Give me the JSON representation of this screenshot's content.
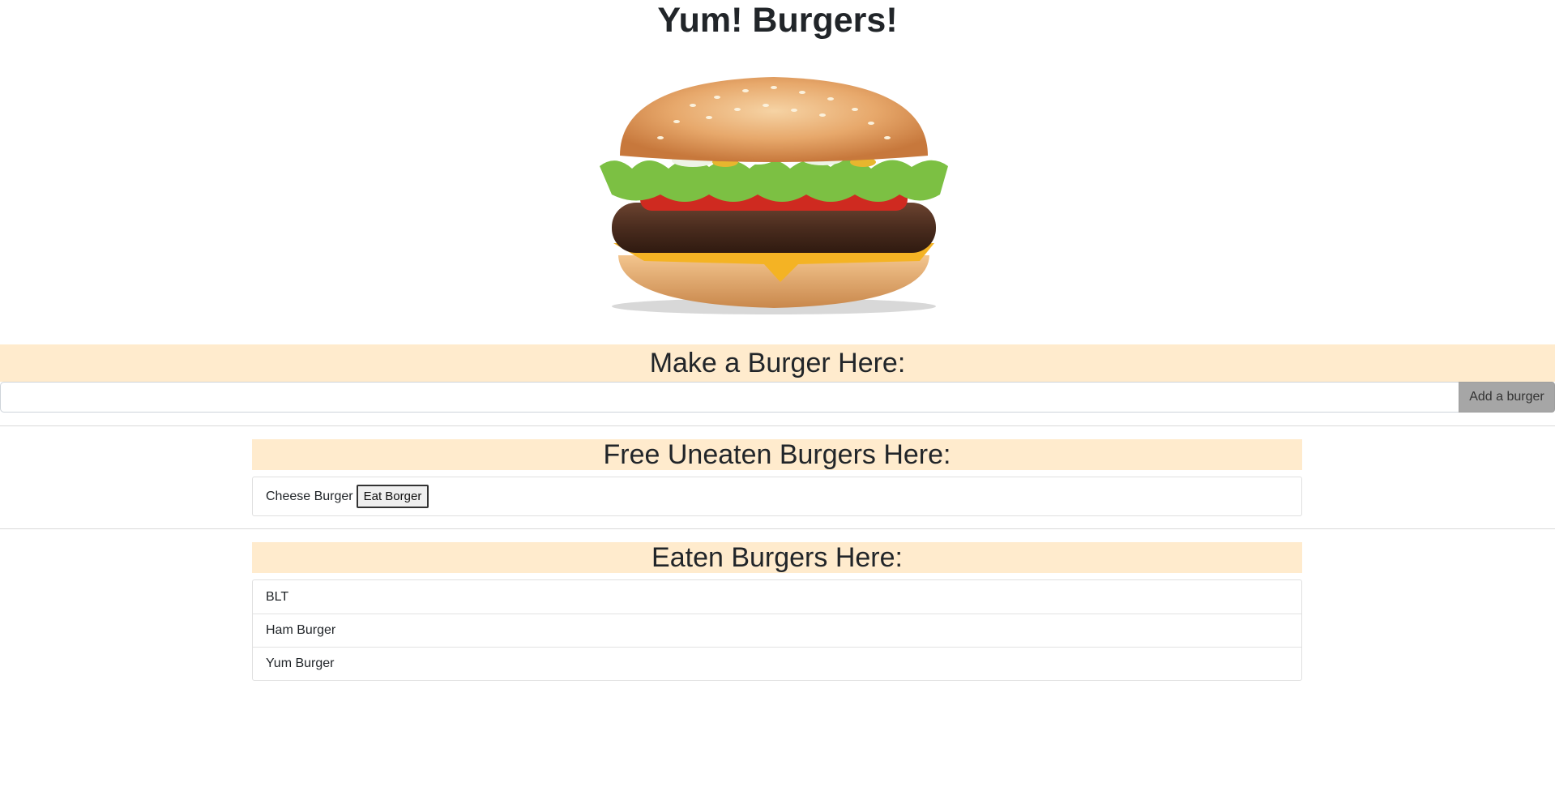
{
  "header": {
    "title": "Yum! Burgers!"
  },
  "hero_image": {
    "icon": "burger-image",
    "description_shown": false
  },
  "make_section": {
    "heading": "Make a Burger Here:",
    "input_value": "",
    "input_placeholder": "",
    "add_button_label": "Add a burger"
  },
  "uneaten_section": {
    "heading": "Free Uneaten Burgers Here:",
    "items": [
      {
        "name": "Cheese Burger",
        "eat_button_label": "Eat Borger"
      }
    ]
  },
  "eaten_section": {
    "heading": "Eaten Burgers Here:",
    "items": [
      {
        "name": "BLT"
      },
      {
        "name": "Ham Burger"
      },
      {
        "name": "Yum Burger"
      }
    ]
  },
  "colors": {
    "heading_band": "#ffebcd",
    "add_button": "#a6a6a6",
    "text": "#212529"
  }
}
